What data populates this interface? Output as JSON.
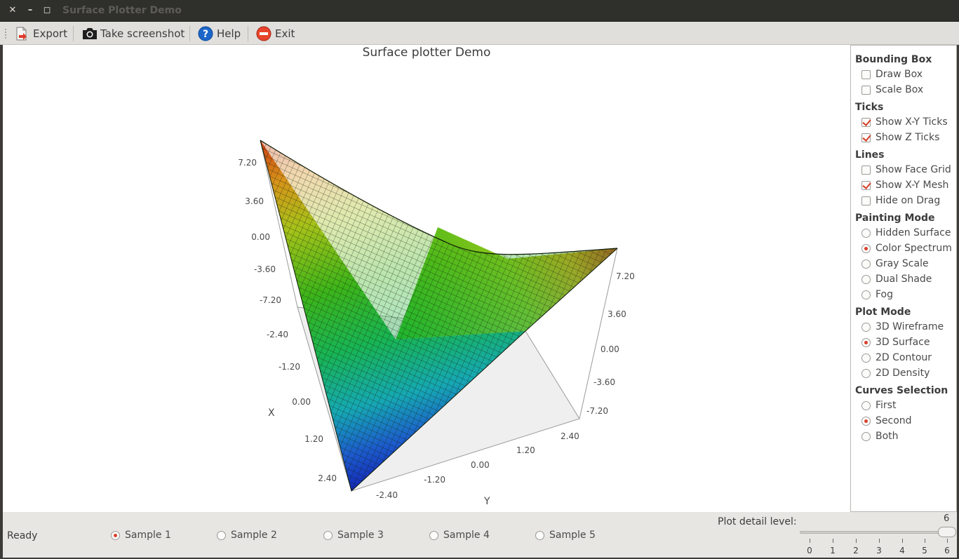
{
  "window": {
    "title": "Surface Plotter Demo",
    "controls": [
      "✕",
      "–",
      "◻"
    ]
  },
  "toolbar": {
    "items": [
      {
        "label": "Export",
        "icon": "export-icon"
      },
      {
        "label": "Take screenshot",
        "icon": "camera-icon"
      },
      {
        "label": "Help",
        "icon": "help-icon"
      },
      {
        "label": "Exit",
        "icon": "exit-icon"
      }
    ]
  },
  "plot": {
    "title": "Surface plotter Demo",
    "x_label": "X",
    "y_label": "Y",
    "z_ticks_left": [
      "7.20",
      "3.60",
      "0.00",
      "-3.60",
      "-7.20"
    ],
    "z_ticks_right": [
      "7.20",
      "3.60",
      "0.00",
      "-3.60",
      "-7.20"
    ],
    "x_ticks": [
      "-2.40",
      "-1.20",
      "0.00",
      "1.20",
      "2.40"
    ],
    "y_ticks": [
      "-2.40",
      "-1.20",
      "0.00",
      "1.20",
      "2.40"
    ]
  },
  "sidebar": {
    "sections": [
      {
        "title": "Bounding Box",
        "type": "checkbox",
        "options": [
          {
            "label": "Draw Box",
            "checked": false
          },
          {
            "label": "Scale Box",
            "checked": false
          }
        ]
      },
      {
        "title": "Ticks",
        "type": "checkbox",
        "options": [
          {
            "label": "Show X-Y Ticks",
            "checked": true
          },
          {
            "label": "Show Z Ticks",
            "checked": true
          }
        ]
      },
      {
        "title": "Lines",
        "type": "checkbox",
        "options": [
          {
            "label": "Show Face Grid",
            "checked": false
          },
          {
            "label": "Show X-Y Mesh",
            "checked": true
          },
          {
            "label": "Hide on Drag",
            "checked": false
          }
        ]
      },
      {
        "title": "Painting Mode",
        "type": "radio",
        "options": [
          {
            "label": "Hidden Surface",
            "checked": false
          },
          {
            "label": "Color Spectrum",
            "checked": true
          },
          {
            "label": "Gray Scale",
            "checked": false
          },
          {
            "label": "Dual Shade",
            "checked": false
          },
          {
            "label": "Fog",
            "checked": false
          }
        ]
      },
      {
        "title": "Plot Mode",
        "type": "radio",
        "options": [
          {
            "label": "3D Wireframe",
            "checked": false
          },
          {
            "label": "3D Surface",
            "checked": true
          },
          {
            "label": "2D Contour",
            "checked": false
          },
          {
            "label": "2D Density",
            "checked": false
          }
        ]
      },
      {
        "title": "Curves Selection",
        "type": "radio",
        "options": [
          {
            "label": "First",
            "checked": false
          },
          {
            "label": "Second",
            "checked": true
          },
          {
            "label": "Both",
            "checked": false
          }
        ]
      }
    ]
  },
  "status": {
    "text": "Ready",
    "samples": [
      {
        "label": "Sample 1",
        "checked": true
      },
      {
        "label": "Sample 2",
        "checked": false
      },
      {
        "label": "Sample 3",
        "checked": false
      },
      {
        "label": "Sample 4",
        "checked": false
      },
      {
        "label": "Sample 5",
        "checked": false
      }
    ],
    "detail_label": "Plot detail level:",
    "detail_value": "6",
    "slider_ticks": [
      "0",
      "1",
      "2",
      "3",
      "4",
      "5",
      "6"
    ]
  },
  "colors": {
    "accent": "#d8402a",
    "titlebar": "#2f2f2c",
    "toolbar": "#e0dfdc"
  }
}
